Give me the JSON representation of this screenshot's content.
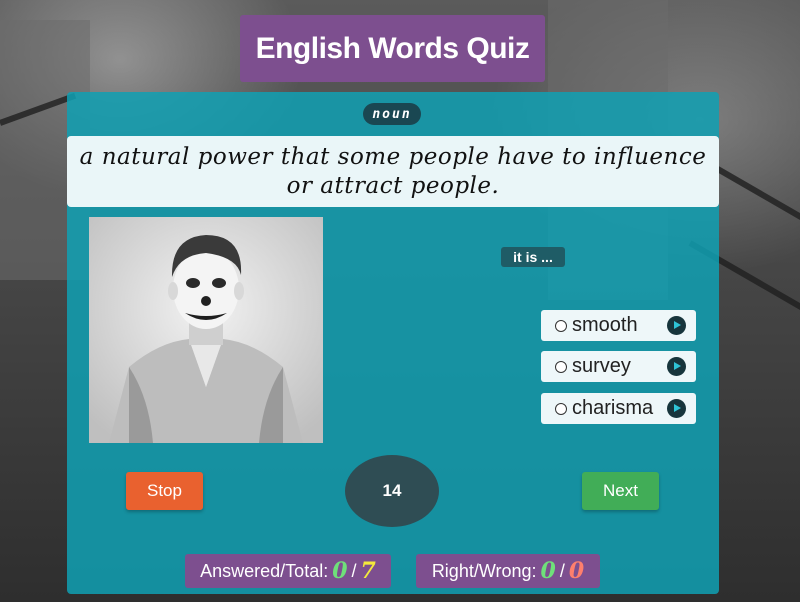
{
  "app": {
    "title": "English Words Quiz"
  },
  "question": {
    "part_of_speech": "noun",
    "definition_line1": "a natural power that some people have to influence",
    "definition_line2": "or attract people."
  },
  "prompt": "it is ...",
  "options": [
    {
      "label": "smooth"
    },
    {
      "label": "survey"
    },
    {
      "label": "charisma"
    }
  ],
  "controls": {
    "stop_label": "Stop",
    "next_label": "Next",
    "timer_value": "14"
  },
  "stats": {
    "answered_label": "Answered/Total:",
    "answered": "0",
    "total": "7",
    "rightwrong_label": "Right/Wrong:",
    "right": "0",
    "wrong": "0",
    "slash": "/"
  },
  "colors": {
    "panel": "#10a0b2",
    "title_bg": "#7d4f8f",
    "stop": "#e9612f",
    "next": "#41ad57",
    "timer": "#2f4d54"
  },
  "icons": [
    "play-icon",
    "radio-icon"
  ]
}
